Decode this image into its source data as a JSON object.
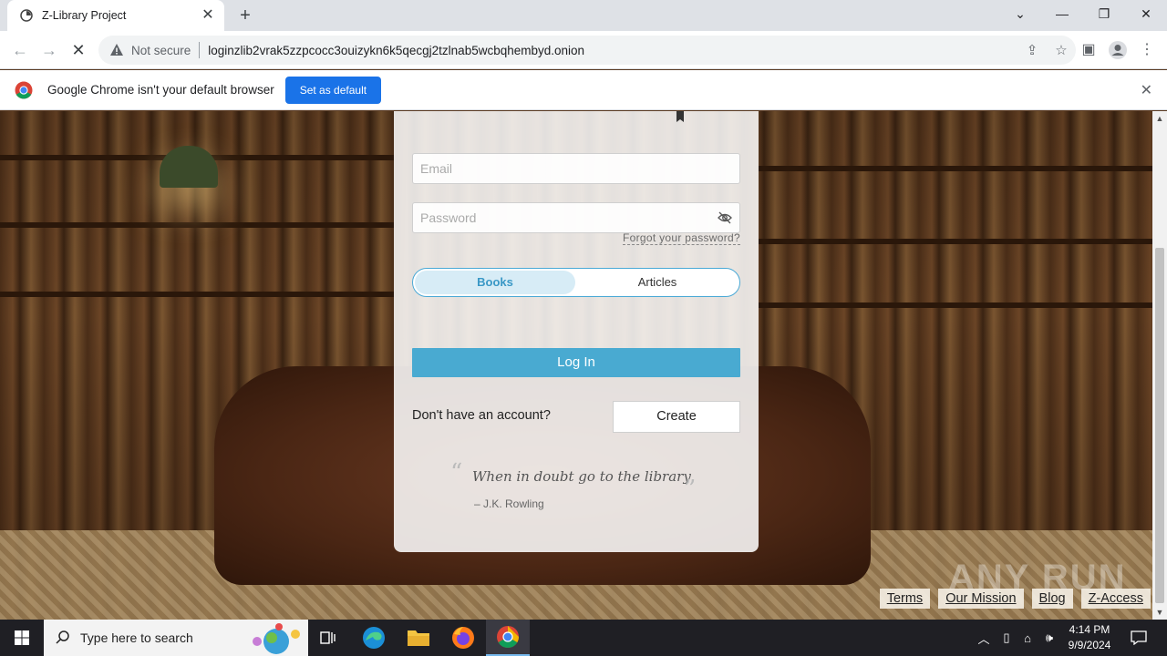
{
  "browser": {
    "tab_title": "Z-Library Project",
    "new_tab_label": "+",
    "not_secure_label": "Not secure",
    "url": "loginzlib2vrak5zzpcocc3ouizykn6k5qecgj2tzlnab5wcbqhembyd.onion",
    "infobar_message": "Google Chrome isn't your default browser",
    "set_default_label": "Set as default"
  },
  "login": {
    "email_placeholder": "Email",
    "password_placeholder": "Password",
    "forgot_label": "Forgot your password?",
    "toggle_books": "Books",
    "toggle_articles": "Articles",
    "login_label": "Log In",
    "no_account_label": "Don't have an account?",
    "create_label": "Create",
    "quote_text": "When in doubt go to the library",
    "quote_author": "– J.K. Rowling"
  },
  "footer": {
    "links": [
      "Terms",
      "Our Mission",
      "Blog",
      "Z-Access"
    ]
  },
  "watermark": "ANY RUN",
  "taskbar": {
    "search_placeholder": "Type here to search",
    "time": "4:14 PM",
    "date": "9/9/2024"
  },
  "colors": {
    "accent": "#49aad1",
    "chrome_blue": "#1a73e8"
  }
}
